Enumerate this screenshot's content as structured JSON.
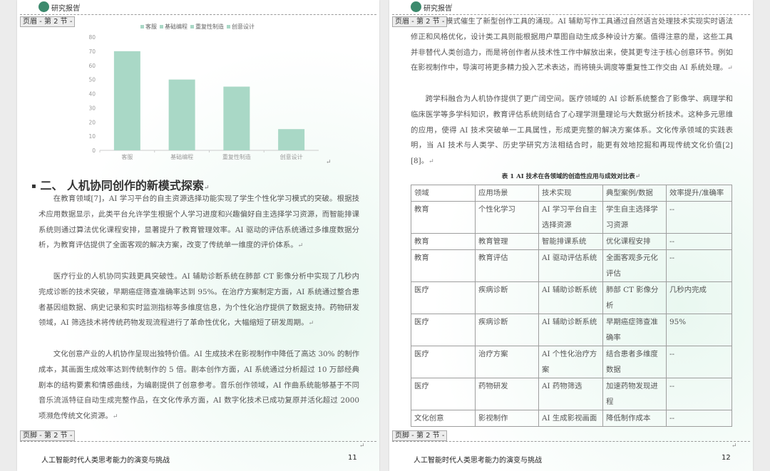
{
  "header": {
    "logo_text": "研究报告"
  },
  "left": {
    "header_tag": "页眉 - 第 2 节 -",
    "footer_tag": "页脚 - 第 2 节 -",
    "footer_title": "人工智能时代人类思考能力的演变与挑战",
    "page_number": "11",
    "heading": "二、  人机协同创作的新模式探索",
    "paragraphs": [
      "在教育领域[7]，AI 学习平台的自主资源选择功能实现了学生个性化学习模式的突破。根据技术应用数据显示，此类平台允许学生根据个人学习进度和兴趣偏好自主选择学习资源，而智能排课系统则通过算法优化课程安排，显著提升了教育管理效率。AI 驱动的评估系统通过多维度数据分析，为教育评估提供了全面客观的解决方案，改变了传统单一维度的评价体系。",
      "医疗行业的人机协同实践更具突破性。AI 辅助诊断系统在肺部 CT 影像分析中实现了几秒内完成诊断的技术突破，早期癌症筛查准确率达到 95%。在治疗方案制定方面，AI 系统通过整合患者基因组数据、病史记录和实时监测指标等多维度信息，为个性化治疗提供了数据支持。药物研发领域，AI 筛选技术将传统药物发现流程进行了革命性优化，大幅缩短了研发周期。",
      "文化创意产业的人机协作呈现出独特价值。AI 生成技术在影视制作中降低了高达 30% 的制作成本，其画面生成效率达到传统制作的 5 倍。剧本创作方面，AI 系统通过分析超过 10 万部经典剧本的结构要素和情感曲线，为编剧提供了创意参考。音乐创作领域，AI 作曲系统能够基于不同音乐流派特征自动生成完整作品，在文化传承方面，AI 数字化技术已成功复原并活化超过 2000 项濒危传统文化资源。"
    ]
  },
  "chart_data": {
    "type": "bar",
    "categories": [
      "客服",
      "基础编程",
      "重复性制造",
      "创意设计"
    ],
    "values": [
      70,
      50,
      45,
      15
    ],
    "legend": [
      "客服",
      "基础编程",
      "重复性制造",
      "创意设计"
    ],
    "ylim": [
      0,
      80
    ],
    "yticks": [
      0,
      10,
      20,
      30,
      40,
      50,
      60,
      70,
      80
    ],
    "bar_color": "#a9d8c6",
    "grid": false,
    "legend_position": "top"
  },
  "right": {
    "header_tag": "页眉 - 第 2 节 -",
    "footer_tag": "页脚 - 第 2 节 -",
    "footer_title": "人工智能时代人类思考能力的演变与挑战",
    "page_number": "12",
    "para1_head": "协同模式催生了新型创作工具的涌现。AI 辅助写作工具通过自然语言处理技术实现实时语法修正和风格优化，设计类工具则能根据用户草图自动生成多种设计方案。值得注意的是，这些工具并非替代人类创造力，而是将创作者从技术性工作中解放出来，使其更专注于核心创意环节。例如在影视制作中，导演可将更多精力投入艺术表达，而将镜头调度等重复性工作交由 AI 系统处理。",
    "para2": "跨学科融合为人机协作提供了更广阔空间。医疗领域的 AI 诊断系统整合了影像学、病理学和临床医学等多学科知识，教育评估系统则结合了心理学测量理论与大数据分析技术。这种多元思维的应用，使得 AI 技术突破单一工具属性，形成更完整的解决方案体系。文化传承领域的实践表明，当 AI 技术与人类学、历史学研究方法相结合时，能更有效地挖掘和再现传统文化价值[2][8]。",
    "table_caption": "表 1 AI 技术在各领域的创造性应用与成效对比表",
    "table_header": [
      "领域",
      "应用场景",
      "技术实现",
      "典型案例/数据",
      "效率提升/准确率"
    ],
    "table_rows": [
      [
        "教育",
        "个性化学习",
        "AI 学习平台自主选择资源",
        "学生自主选择学习资源",
        "--"
      ],
      [
        "教育",
        "教育管理",
        "智能排课系统",
        "优化课程安排",
        "--"
      ],
      [
        "教育",
        "教育评估",
        "AI 驱动评估系统",
        "全面客观多元化评估",
        "--"
      ],
      [
        "医疗",
        "疾病诊断",
        "AI 辅助诊断系统",
        "肺部 CT 影像分析",
        "几秒内完成"
      ],
      [
        "医疗",
        "疾病诊断",
        "AI 辅助诊断系统",
        "早期癌症筛查准确率",
        "95%"
      ],
      [
        "医疗",
        "治疗方案",
        "AI 个性化治疗方案",
        "结合患者多维度数据",
        "--"
      ],
      [
        "医疗",
        "药物研发",
        "AI 药物筛选",
        "加速药物发现进程",
        "--"
      ],
      [
        "文化创意",
        "影视制作",
        "AI 生成影视画面",
        "降低制作成本",
        "--"
      ]
    ]
  }
}
